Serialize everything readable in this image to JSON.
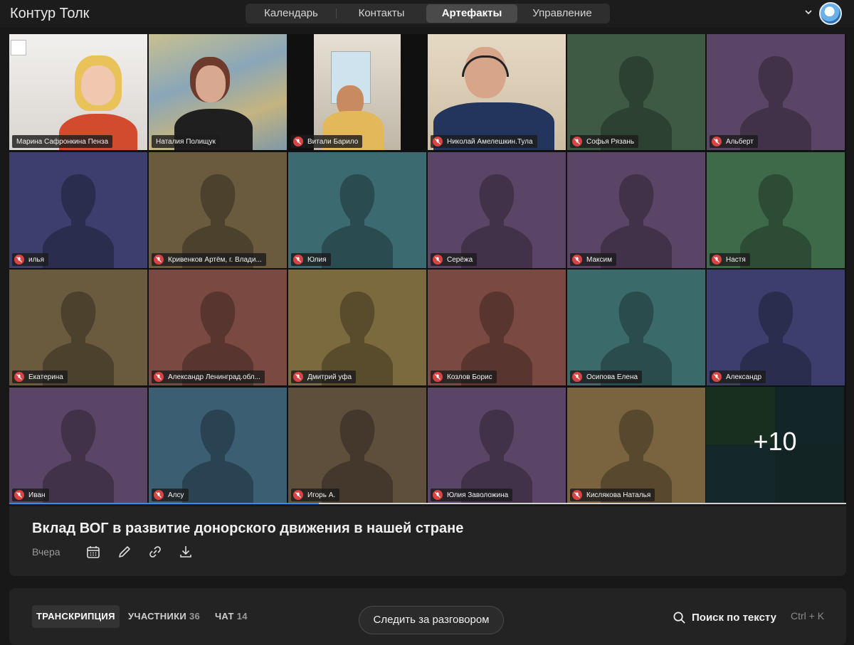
{
  "app": {
    "title": "Контур Толк"
  },
  "nav": {
    "tabs": [
      "Календарь",
      "Контакты",
      "Артефакты",
      "Управление"
    ],
    "active": "Артефакты"
  },
  "grid": {
    "tiles": [
      {
        "name": "Марина Сафронкина Пенза",
        "muted": false,
        "video": true
      },
      {
        "name": "Наталия Полищук",
        "muted": false,
        "video": true,
        "speaking": true
      },
      {
        "name": "Витали Барило",
        "muted": true,
        "video": true
      },
      {
        "name": "Николай Амелешкин.Тула",
        "muted": true,
        "video": true
      },
      {
        "name": "Софья Рязань",
        "muted": true,
        "color": "#3e5a44"
      },
      {
        "name": "Альберт",
        "muted": true,
        "color": "#5b4566"
      },
      {
        "name": "илья",
        "muted": true,
        "color": "#3c3f6e"
      },
      {
        "name": "Кривенков Артём, г. Влади...",
        "muted": true,
        "color": "#6a5a3e"
      },
      {
        "name": "Юлия",
        "muted": true,
        "color": "#3b6a70"
      },
      {
        "name": "Серёжа",
        "muted": true,
        "color": "#5b4566"
      },
      {
        "name": "Максим",
        "muted": true,
        "color": "#5b4566"
      },
      {
        "name": "Настя",
        "muted": true,
        "color": "#3e6a4a"
      },
      {
        "name": "Екатерина",
        "muted": true,
        "color": "#6a5a3e"
      },
      {
        "name": "Александр Ленинград.обл...",
        "muted": true,
        "color": "#7a4a42"
      },
      {
        "name": "Дмитрий уфа",
        "muted": true,
        "color": "#7a6a3e"
      },
      {
        "name": "Козлов Борис",
        "muted": true,
        "color": "#7a4a42"
      },
      {
        "name": "Осипова Елена",
        "muted": true,
        "color": "#3b6a6a"
      },
      {
        "name": "Александр",
        "muted": true,
        "color": "#3c3f6e"
      },
      {
        "name": "Иван",
        "muted": true,
        "color": "#5b4566"
      },
      {
        "name": "Алсу",
        "muted": true,
        "color": "#3b5e72"
      },
      {
        "name": "Игорь А.",
        "muted": true,
        "color": "#5e4e3c"
      },
      {
        "name": "Юлия Заволожина",
        "muted": true,
        "color": "#5b4566"
      },
      {
        "name": "Кислякова Наталья",
        "muted": true,
        "color": "#7a6440"
      }
    ],
    "more_label": "+10",
    "playback_progress": 0.37
  },
  "meeting": {
    "title": "Вклад ВОГ в развитие донорского движения в нашей стране",
    "date": "Вчера"
  },
  "panel": {
    "tabs": [
      {
        "label": "ТРАНСКРИПЦИЯ",
        "count": ""
      },
      {
        "label": "УЧАСТНИКИ",
        "count": "36"
      },
      {
        "label": "ЧАТ",
        "count": "14"
      }
    ],
    "follow_button": "Следить за разговором",
    "search_label": "Поиск по тексту",
    "search_shortcut": "Ctrl + K"
  },
  "colors": {
    "accent": "#2f8ff0",
    "mute": "#d84444"
  }
}
